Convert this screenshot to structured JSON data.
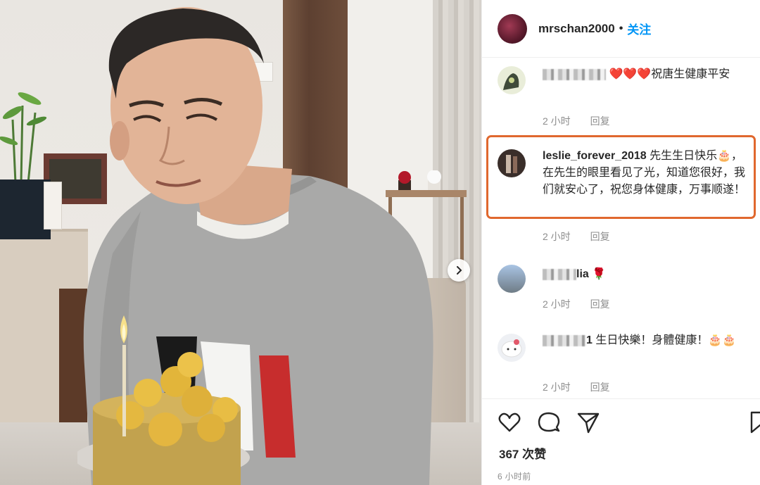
{
  "header": {
    "username": "mrschan2000",
    "separator": "•",
    "follow_label": "关注"
  },
  "comments": [
    {
      "username_blurred": true,
      "username": "",
      "hearts": "❤️❤️❤️",
      "text": "祝唐生健康平安",
      "time": "2 小时",
      "reply_label": "回复"
    },
    {
      "username": "leslie_forever_2018",
      "text": "先生生日快乐🎂，在先生的眼里看见了光，知道您很好，我们就安心了，祝您身体健康，万事顺遂！",
      "time": "2 小时",
      "reply_label": "回复",
      "highlighted": true
    },
    {
      "username_blurred": true,
      "username_suffix": "lia",
      "text": "🌹",
      "time": "2 小时",
      "reply_label": "回复"
    },
    {
      "username_blurred": true,
      "username_suffix": "1",
      "text": "生日快樂！身體健康！🎂🎂",
      "time": "2 小时",
      "reply_label": "回复"
    }
  ],
  "actions": {
    "likes": "367 次赞",
    "timestamp": "6 小时前"
  },
  "colors": {
    "accent": "#0095f6",
    "highlight_border": "#e0682e",
    "muted": "#8e8e8e"
  },
  "icons": [
    "next-arrow-icon",
    "heart-icon",
    "comment-icon",
    "share-icon",
    "bookmark-icon"
  ]
}
